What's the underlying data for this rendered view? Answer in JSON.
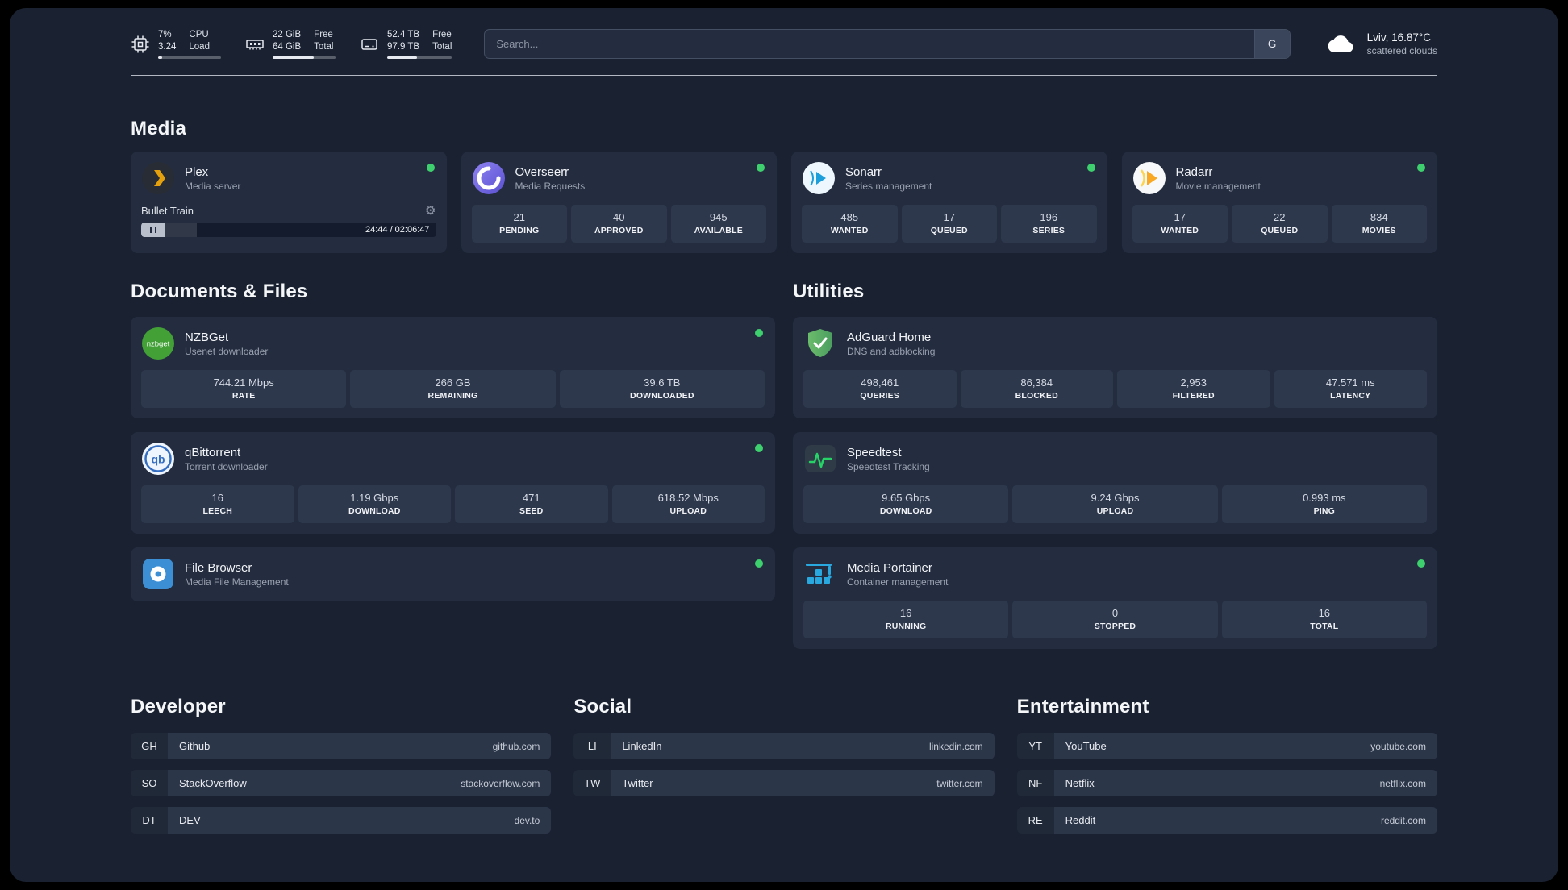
{
  "topbar": {
    "cpu": {
      "percent": "7%",
      "load": "3.24",
      "label_top": "CPU",
      "label_bottom": "Load",
      "bar_percent": 7
    },
    "memory": {
      "free": "22 GiB",
      "total": "64 GiB",
      "label_top": "Free",
      "label_bottom": "Total",
      "bar_percent": 66
    },
    "disk": {
      "free": "52.4 TB",
      "total": "97.9 TB",
      "label_top": "Free",
      "label_bottom": "Total",
      "bar_percent": 46
    },
    "search": {
      "placeholder": "Search...",
      "provider_button": "G"
    },
    "weather": {
      "location": "Lviv, 16.87°C",
      "condition": "scattered clouds"
    }
  },
  "sections": {
    "media": "Media",
    "documents": "Documents & Files",
    "utilities": "Utilities",
    "developer": "Developer",
    "social": "Social",
    "entertainment": "Entertainment"
  },
  "services": {
    "plex": {
      "name": "Plex",
      "subtitle": "Media server",
      "player": {
        "track": "Bullet Train",
        "time": "24:44 / 02:06:47",
        "progress_percent": 19
      }
    },
    "overseerr": {
      "name": "Overseerr",
      "subtitle": "Media Requests",
      "stats": [
        {
          "value": "21",
          "label": "PENDING"
        },
        {
          "value": "40",
          "label": "APPROVED"
        },
        {
          "value": "945",
          "label": "AVAILABLE"
        }
      ]
    },
    "sonarr": {
      "name": "Sonarr",
      "subtitle": "Series management",
      "stats": [
        {
          "value": "485",
          "label": "WANTED"
        },
        {
          "value": "17",
          "label": "QUEUED"
        },
        {
          "value": "196",
          "label": "SERIES"
        }
      ]
    },
    "radarr": {
      "name": "Radarr",
      "subtitle": "Movie management",
      "stats": [
        {
          "value": "17",
          "label": "WANTED"
        },
        {
          "value": "22",
          "label": "QUEUED"
        },
        {
          "value": "834",
          "label": "MOVIES"
        }
      ]
    },
    "nzbget": {
      "name": "NZBGet",
      "subtitle": "Usenet downloader",
      "stats": [
        {
          "value": "744.21 Mbps",
          "label": "RATE"
        },
        {
          "value": "266 GB",
          "label": "REMAINING"
        },
        {
          "value": "39.6 TB",
          "label": "DOWNLOADED"
        }
      ]
    },
    "qbittorrent": {
      "name": "qBittorrent",
      "subtitle": "Torrent downloader",
      "stats": [
        {
          "value": "16",
          "label": "LEECH"
        },
        {
          "value": "1.19 Gbps",
          "label": "DOWNLOAD"
        },
        {
          "value": "471",
          "label": "SEED"
        },
        {
          "value": "618.52 Mbps",
          "label": "UPLOAD"
        }
      ]
    },
    "filebrowser": {
      "name": "File Browser",
      "subtitle": "Media File Management"
    },
    "adguard": {
      "name": "AdGuard Home",
      "subtitle": "DNS and adblocking",
      "stats": [
        {
          "value": "498,461",
          "label": "QUERIES"
        },
        {
          "value": "86,384",
          "label": "BLOCKED"
        },
        {
          "value": "2,953",
          "label": "FILTERED"
        },
        {
          "value": "47.571 ms",
          "label": "LATENCY"
        }
      ]
    },
    "speedtest": {
      "name": "Speedtest",
      "subtitle": "Speedtest Tracking",
      "stats": [
        {
          "value": "9.65 Gbps",
          "label": "DOWNLOAD"
        },
        {
          "value": "9.24 Gbps",
          "label": "UPLOAD"
        },
        {
          "value": "0.993 ms",
          "label": "PING"
        }
      ]
    },
    "portainer": {
      "name": "Media Portainer",
      "subtitle": "Container management",
      "stats": [
        {
          "value": "16",
          "label": "RUNNING"
        },
        {
          "value": "0",
          "label": "STOPPED"
        },
        {
          "value": "16",
          "label": "TOTAL"
        }
      ]
    }
  },
  "bookmarks": {
    "developer": [
      {
        "abbr": "GH",
        "name": "Github",
        "url": "github.com"
      },
      {
        "abbr": "SO",
        "name": "StackOverflow",
        "url": "stackoverflow.com"
      },
      {
        "abbr": "DT",
        "name": "DEV",
        "url": "dev.to"
      }
    ],
    "social": [
      {
        "abbr": "LI",
        "name": "LinkedIn",
        "url": "linkedin.com"
      },
      {
        "abbr": "TW",
        "name": "Twitter",
        "url": "twitter.com"
      }
    ],
    "entertainment": [
      {
        "abbr": "YT",
        "name": "YouTube",
        "url": "youtube.com"
      },
      {
        "abbr": "NF",
        "name": "Netflix",
        "url": "netflix.com"
      },
      {
        "abbr": "RE",
        "name": "Reddit",
        "url": "reddit.com"
      }
    ]
  },
  "colors": {
    "status_online": "#3ecf6e",
    "background": "#1a2232",
    "card": "#242d3f",
    "tile": "#2d384d"
  }
}
